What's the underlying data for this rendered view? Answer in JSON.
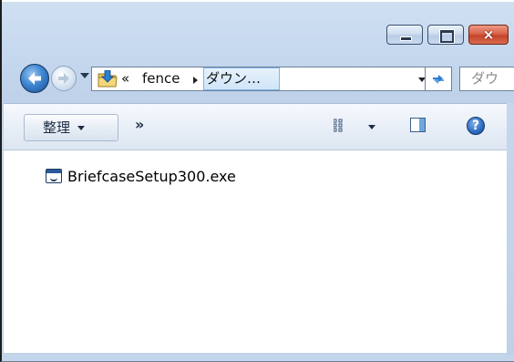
{
  "window": {
    "controls": {
      "minimize": "minimize",
      "maximize": "maximize",
      "close": "×"
    }
  },
  "nav": {
    "breadcrumb": {
      "overflow": "«",
      "items": [
        "fence",
        "ダウン…"
      ]
    },
    "search": {
      "placeholder": "ダウ"
    }
  },
  "toolbar": {
    "organize_label": "整理",
    "more_label": "»",
    "help_label": "?"
  },
  "files": [
    {
      "name": "BriefcaseSetup300.exe",
      "icon": "exe-icon"
    }
  ]
}
